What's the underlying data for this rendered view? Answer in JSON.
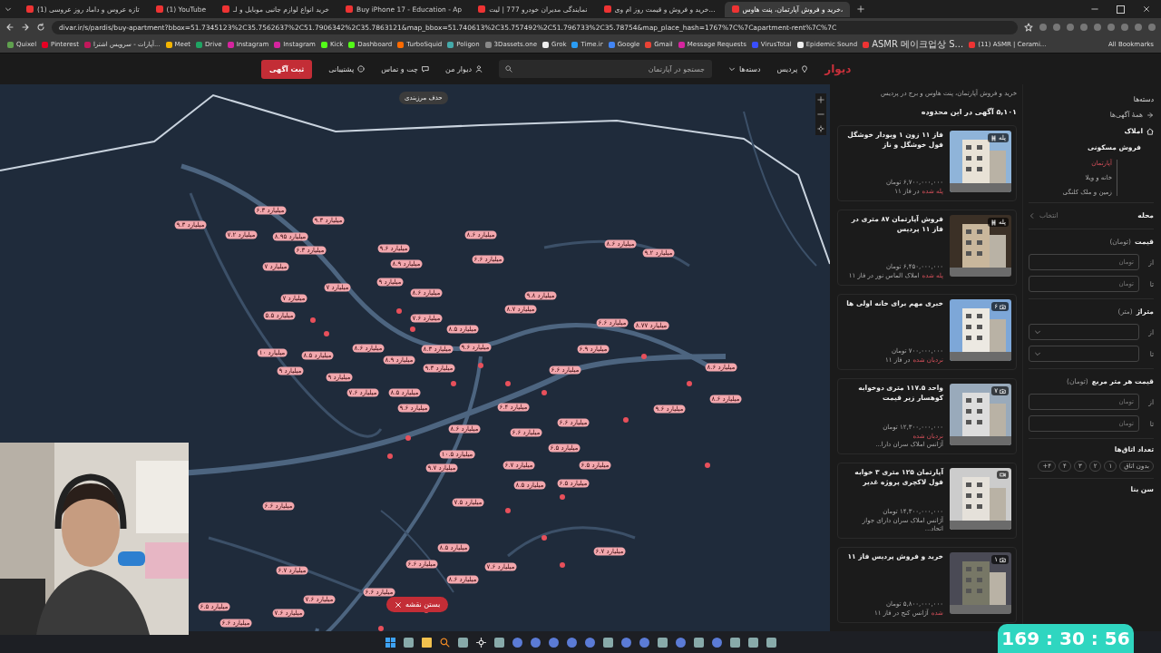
{
  "browser": {
    "tabs": [
      {
        "title": "خرید و فروش آپارتمان، پنت هاوس،",
        "selected": true
      },
      {
        "title": "خرید و فروش و قیمت روز ام وی...",
        "selected": false
      },
      {
        "title": "نمایندگی مدیران خودرو 777 | لیت",
        "selected": false
      },
      {
        "title": "Buy iPhone 17 - Education - Ap",
        "selected": false
      },
      {
        "title": "خرید انواع لوازم جانبی موبایل و لـ",
        "selected": false
      },
      {
        "title": "(1) YouTube",
        "selected": false
      },
      {
        "title": "(1) تازه عروس و داماد روز عروسی",
        "selected": false
      }
    ],
    "url": "divar.ir/s/pardis/buy-apartment?bbox=51.7345123%2C35.7562637%2C51.7906342%2C35.7863121&map_bbox=51.740613%2C35.757492%2C51.796733%2C35.78754&map_place_hash=1767%7C%7Capartment-rent%7C%7C",
    "bookmarks": [
      "(11) ASMR | Cerami...",
      "ASMR 메이크업상 S...",
      "Epidemic Sound",
      "VirusTotal",
      "Message Requests",
      "Gmail",
      "Google",
      "Time.ir",
      "Grok",
      "3Dassets.one",
      "Poligon",
      "TurboSquid",
      "Dashboard",
      "Kick",
      "Instagram",
      "Instagram",
      "Drive",
      "Meet",
      "آپارات - سرویس اشترا...",
      "Pinterest",
      "Quixel"
    ],
    "all_bookmarks": "All Bookmarks"
  },
  "header": {
    "logo": "دیوار",
    "city": "پردیس",
    "categories": "دسته‌ها",
    "search_placeholder": "جستجو در آپارتمان",
    "nav": [
      "دیوار من",
      "چت و تماس",
      "پشتیبانی"
    ],
    "post_button": "ثبت آگهی"
  },
  "map": {
    "remove_border": "حذف مرزبندی",
    "close_map": "بستن نقشه",
    "pins": [
      "۹.۳ میلیارد",
      "۷.۲ میلیارد",
      "۶.۳ میلیارد",
      "۸.۹۵ میلیارد",
      "۹.۳ میلیارد",
      "۶.۳ میلیارد",
      "۷ میلیارد",
      "۷ میلیارد",
      "۵.۵ میلیارد",
      "۱۰ میلیارد",
      "۹ میلیارد",
      "۸.۵ میلیارد",
      "۹.۶ میلیارد",
      "۸.۹ میلیارد",
      "۸.۶ میلیارد",
      "۶.۶ میلیارد",
      "۹.۲ میلیارد",
      "۸.۶ میلیارد",
      "۸.۷۷ میلیارد",
      "۶.۶ میلیارد",
      "۶.۹ میلیارد",
      "۸.۶ میلیارد",
      "۶.۶ میلیارد",
      "۸.۶ میلیارد",
      "۹.۶ میلیارد",
      "۶.۴ میلیارد",
      "۶.۶ میلیارد",
      "۶.۶ میلیارد",
      "۸.۶ میلیارد",
      "۶.۵ میلیارد",
      "۱۰.۵ میلیارد",
      "۶.۵ میلیارد",
      "۶.۷ میلیارد",
      "۹.۷ میلیارد",
      "۶.۵ میلیارد",
      "۸.۵ میلیارد",
      "۷.۵ میلیارد",
      "۶.۶ میلیارد",
      "۶.۷ میلیارد",
      "۸.۵ میلیارد",
      "۶.۶ میلیارد",
      "۸.۶ میلیارد",
      "۷.۶ میلیارد",
      "۶.۷ میلیارد",
      "۶.۶ میلیارد",
      "۷.۶ میلیارد",
      "۷.۶ میلیارد",
      "۶.۵ میلیارد",
      "۶.۶ میلیارد",
      "۹ میلیارد",
      "۷.۶ میلیارد",
      "۹.۶ میلیارد",
      "۸.۳ میلیارد",
      "۹.۳ میلیارد",
      "۸.۵ میلیارد",
      "۷.۶ میلیارد",
      "۹.۶ میلیارد",
      "۹ میلیارد",
      "۸.۶ میلیارد",
      "۷ میلیارد",
      "۹.۸ میلیارد",
      "۸.۷ میلیارد",
      "۸.۵ میلیارد",
      "۸.۹ میلیارد",
      "۸.۶ میلیارد"
    ]
  },
  "listings": {
    "breadcrumb": "خرید و فروش آپارتمان، پنت هاوس و برج در پردیس",
    "count": "۵,۱۰۱ آگهی در این محدوده",
    "items": [
      {
        "title": "فاز ۱۱ زون ۱ ویودار خوشگل فول خوشگل و ناز",
        "price": "۶,۷۰۰,۰۰۰,۰۰۰ تومان",
        "badge": {
          "kind": "ladder",
          "text": "پله"
        },
        "status": "پله شده",
        "location": "در فاز ۱۱"
      },
      {
        "title": "فروش آپارتمان ۸۷ متری در فاز ۱۱ پردیس",
        "price": "۶,۴۵۰,۰۰۰,۰۰۰ تومان",
        "badge": {
          "kind": "ladder",
          "text": "پله"
        },
        "status": "پله شده",
        "location": "املاک الماس نور در فاز ۱۱"
      },
      {
        "title": "خبری مهم برای خانه اولی ها",
        "price": "۷۰۰,۰۰۰,۰۰۰ تومان",
        "badge": {
          "kind": "photos",
          "text": "۶"
        },
        "status": "نردبان شده",
        "location": "در فاز ۱۱"
      },
      {
        "title": "واحد ۱۱۷.۵ متری دوخوابه کوهسار زیر قیمت",
        "price": "۱۲,۳۰۰,۰۰۰,۰۰۰ تومان",
        "badge": {
          "kind": "photos",
          "text": "۷"
        },
        "status": "نردبان شده",
        "location": "آژانس املاک سران دارا..."
      },
      {
        "title": "آپارتمان ۱۲۵ متری ۳ خوابه فول لاکچری پروژه غدیر",
        "price": "۱۴,۳۰۰,۰۰۰,۰۰۰ تومان",
        "badge": {
          "kind": "video"
        },
        "location": "آژانس املاک سران دارای جواز اتحاد..."
      },
      {
        "title": "خرید و فروش پردیس فاز ۱۱",
        "price": "۵,۸۰۰,۰۰۰,۰۰۰ تومان",
        "badge": {
          "kind": "photos",
          "text": "۱"
        },
        "status": "شده",
        "location": "آژانس کنج در فاز ۱۱"
      }
    ]
  },
  "filters": {
    "categories_title": "دسته‌ها",
    "all_ads": "همهٔ آگهی‌ها",
    "real_estate": "املاک",
    "residential_sale": "فروش مسکونی",
    "subcategories": [
      {
        "label": "آپارتمان",
        "selected": true
      },
      {
        "label": "خانه و ویلا",
        "selected": false
      },
      {
        "label": "زمین و ملک کلنگی",
        "selected": false
      }
    ],
    "neighborhood": {
      "label": "محله",
      "value": "انتخاب"
    },
    "ranges": [
      {
        "label": "قیمت",
        "unit": "(تومان)",
        "kind": "input",
        "from": {
          "label": "از",
          "placeholder": "تومان"
        },
        "to": {
          "label": "تا",
          "placeholder": "تومان"
        }
      },
      {
        "label": "متراژ",
        "unit": "(متر)",
        "kind": "select",
        "from": {
          "label": "از"
        },
        "to": {
          "label": "تا"
        }
      },
      {
        "label": "قیمت هر متر مربع",
        "unit": "(تومان)",
        "kind": "input",
        "from": {
          "label": "از",
          "placeholder": "تومان"
        },
        "to": {
          "label": "تا",
          "placeholder": "تومان"
        }
      }
    ],
    "rooms_title": "تعداد اتاق‌ها",
    "rooms": [
      "بدون اتاق",
      "۱",
      "۲",
      "۳",
      "۴",
      "۴+"
    ],
    "building_age": "سن بنا"
  },
  "timer": "169 : 30 : 56"
}
